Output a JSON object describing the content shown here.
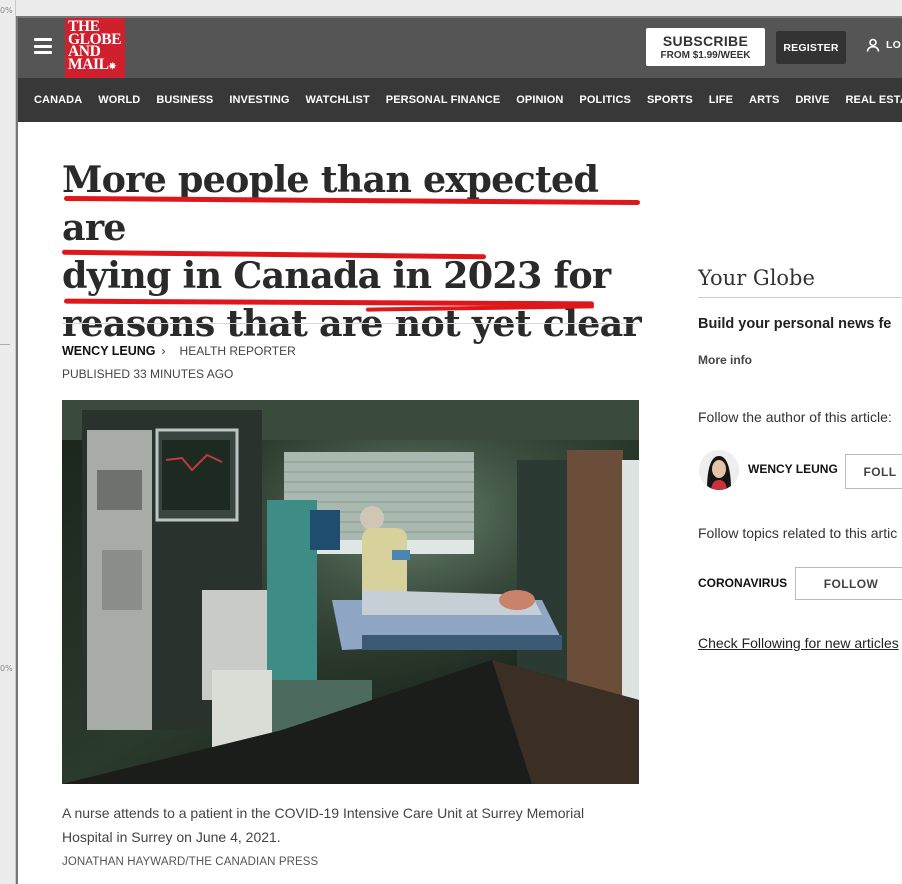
{
  "ruler": {
    "top_mark": "0%",
    "mid_mark": "0%"
  },
  "header": {
    "logo_lines": [
      "THE",
      "GLOBE",
      "AND",
      "MAIL"
    ],
    "logo_leaf": "✸",
    "subscribe_label": "SUBSCRIBE",
    "subscribe_price": "FROM $1.99/WEEK",
    "register_label": "REGISTER",
    "login_label": "LO"
  },
  "nav": {
    "items": [
      "CANADA",
      "WORLD",
      "BUSINESS",
      "INVESTING",
      "WATCHLIST",
      "PERSONAL FINANCE",
      "OPINION",
      "POLITICS",
      "SPORTS",
      "LIFE",
      "ARTS",
      "DRIVE",
      "REAL ESTATE"
    ]
  },
  "article": {
    "headline_lines": [
      "More people than expected are",
      "dying in Canada in 2023 for",
      "reasons that are not yet clear"
    ],
    "author": "WENCY LEUNG",
    "author_role": "HEALTH REPORTER",
    "published": "PUBLISHED 33 MINUTES AGO",
    "caption": "A nurse attends to a patient in the COVID-19 Intensive Care Unit at Surrey Memorial Hospital in Surrey on June 4, 2021.",
    "photo_credit": "JONATHAN HAYWARD/THE CANADIAN PRESS",
    "annotation_color": "#e0171a"
  },
  "sidebar": {
    "title": "Your Globe",
    "build_text": "Build your personal news fe",
    "more_info": "More info",
    "follow_author_text": "Follow the author of this article:",
    "author_name": "WENCY LEUNG",
    "author_follow_label": "FOLL",
    "follow_topics_text": "Follow topics related to this artic",
    "topic_name": "CORONAVIRUS",
    "topic_follow_label": "FOLLOW",
    "check_following": "Check Following for new articles"
  }
}
